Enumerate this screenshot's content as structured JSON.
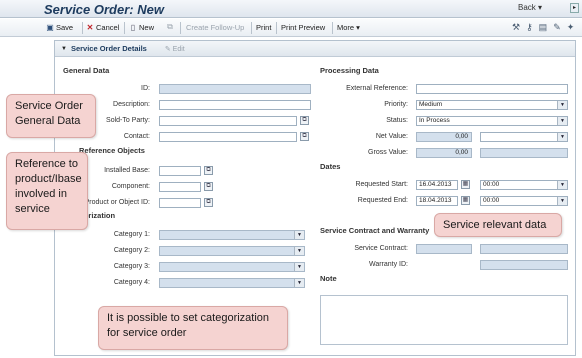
{
  "window": {
    "title": "Service Order: New",
    "back_label": "Back",
    "back_arrow": "▾"
  },
  "toolbar": {
    "save": "Save",
    "cancel": "Cancel",
    "new": "New",
    "create_follow_up": "Create Follow-Up",
    "print": "Print",
    "print_preview": "Print Preview",
    "more": "More",
    "more_arrow": "▾"
  },
  "panel": {
    "title": "Service Order Details",
    "edit": "Edit"
  },
  "general": {
    "title": "General Data",
    "id_label": "ID:",
    "id_value": "",
    "description_label": "Description:",
    "description_value": "",
    "sold_to_label": "Sold-To Party:",
    "sold_to_value": "",
    "contact_label": "Contact:",
    "contact_value": ""
  },
  "reference": {
    "title": "Reference Objects",
    "installed_base_label": "Installed Base:",
    "component_label": "Component:",
    "product_label": "Product or Object ID:"
  },
  "categorization": {
    "title": "Categorization",
    "cat1_label": "Category 1:",
    "cat2_label": "Category 2:",
    "cat3_label": "Category 3:",
    "cat4_label": "Category 4:"
  },
  "processing": {
    "title": "Processing Data",
    "ext_ref_label": "External Reference:",
    "ext_ref_value": "",
    "priority_label": "Priority:",
    "priority_value": "Medium",
    "status_label": "Status:",
    "status_value": "In Process",
    "net_value_label": "Net Value:",
    "net_value": "0,00",
    "gross_value_label": "Gross Value:",
    "gross_value": "0,00"
  },
  "dates": {
    "title": "Dates",
    "req_start_label": "Requested Start:",
    "req_start_date": "16.04.2013",
    "req_start_time": "00:00",
    "req_end_label": "Requested End:",
    "req_end_date": "18.04.2013",
    "req_end_time": "00:00"
  },
  "contract": {
    "title": "Service Contract and Warranty",
    "service_contract_label": "Service Contract:",
    "warranty_label": "Warranty ID:"
  },
  "note": {
    "title": "Note"
  },
  "callouts": {
    "general": "Service Order General Data",
    "reference": "Reference to product/Ibase involved in service",
    "categorization": "It is possible to set categorization for service order",
    "service_data": "Service relevant data"
  },
  "colors": {
    "callout_bg": "#f5d3d1",
    "readonly_field": "#d4e0ed",
    "title_text": "#1d3b5e"
  }
}
